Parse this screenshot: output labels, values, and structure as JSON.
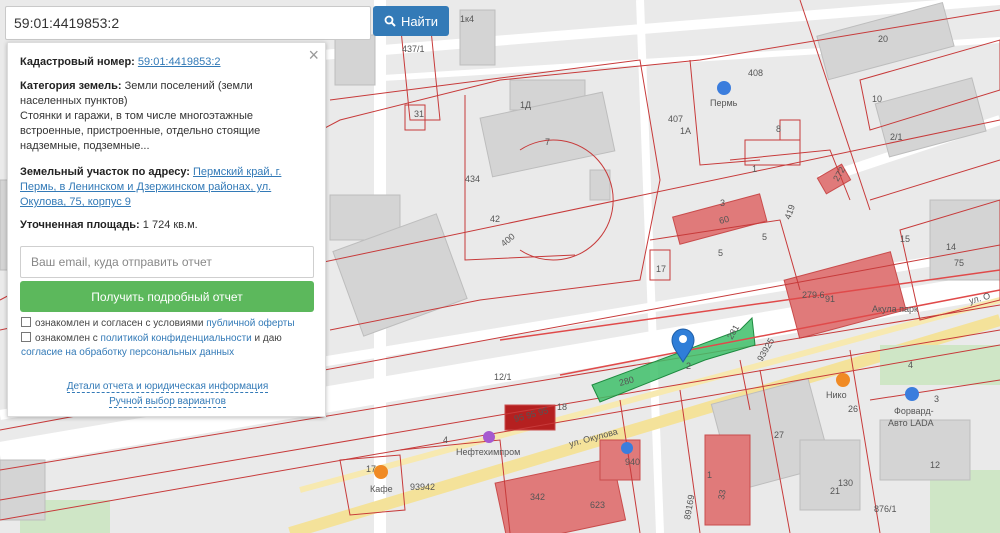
{
  "search": {
    "value": "59:01:4419853:2",
    "button_label": "Найти",
    "icon": "search-icon"
  },
  "panel": {
    "close": "×",
    "cadastral_label": "Кадастровый номер:",
    "cadastral_value": "59:01:4419853:2",
    "category_label": "Категория земель:",
    "category_value": "Земли поселений (земли населенных пунктов)",
    "usage_value": "Стоянки и гаражи, в том числе многоэтажные встроенные, пристроенные, отдельно стоящие надземные, подземные...",
    "address_label": "Земельный участок по адресу:",
    "address_value": "Пермский край, г. Пермь, в Ленинском и Дзержинском районах, ул. Окулова, 75, корпус 9",
    "area_label": "Уточненная площадь:",
    "area_value": "1 724 кв.м.",
    "email_placeholder": "Ваш email, куда отправить отчет",
    "report_button": "Получить подробный отчет",
    "consent1_text": "ознакомлен и согласен с условиями",
    "consent1_link": "публичной оферты",
    "consent2_text": "ознакомлен с",
    "consent2_link1": "политикой конфиденциальности",
    "consent2_mid": "и даю",
    "consent2_link2": "согласие на обработку персональных данных",
    "link_details": "Детали отчета и юридическая информация",
    "link_manual": "Ручной выбор вариантов"
  },
  "map": {
    "selected_parcel": "2",
    "labels": {
      "l_1x4": "1к4",
      "l_4371": "437/1",
      "l_31": "31",
      "l_1d": "1Д",
      "l_7": "7",
      "l_434": "434",
      "l_42": "42",
      "l_400": "400",
      "l_perm": "Пермь",
      "l_408": "408",
      "l_407": "407",
      "l_1a": "1А",
      "l_8": "8",
      "l_1": "1",
      "l_3": "3",
      "l_60": "60",
      "l_5": "5",
      "l_5b": "5",
      "l_419": "419",
      "l_17": "17",
      "l_20": "20",
      "l_10": "10",
      "l_21": "2/1",
      "l_272": "272",
      "l_14": "14",
      "l_15": "15",
      "l_75": "75",
      "l_2796": "279.6",
      "l_91": "91",
      "l_akula": "Акула парк",
      "l_ulo": "ул. О",
      "l_281": "281",
      "l_280": "280",
      "l_121": "12/1",
      "l_18": "18",
      "l_9595": "95 95 95",
      "l_okulova": "ул. Окулова",
      "l_neft": "Нефтехимпром",
      "l_4": "4",
      "l_17b": "17",
      "l_kafe": "Кафе",
      "l_93942": "93942",
      "l_342": "342",
      "l_623": "623",
      "l_940": "940",
      "l_1b": "1",
      "l_27": "27",
      "l_93925": "93925",
      "l_niko": "Нико",
      "l_26": "26",
      "l_4b": "4",
      "l_forvard": "Форвард-",
      "l_avto": "Авто LADA",
      "l_12": "12",
      "l_21b": "21",
      "l_130": "130",
      "l_8761": "876/1",
      "l_89169": "89169",
      "l_33": "33",
      "l_3b": "3",
      "l_2b": "2"
    }
  }
}
